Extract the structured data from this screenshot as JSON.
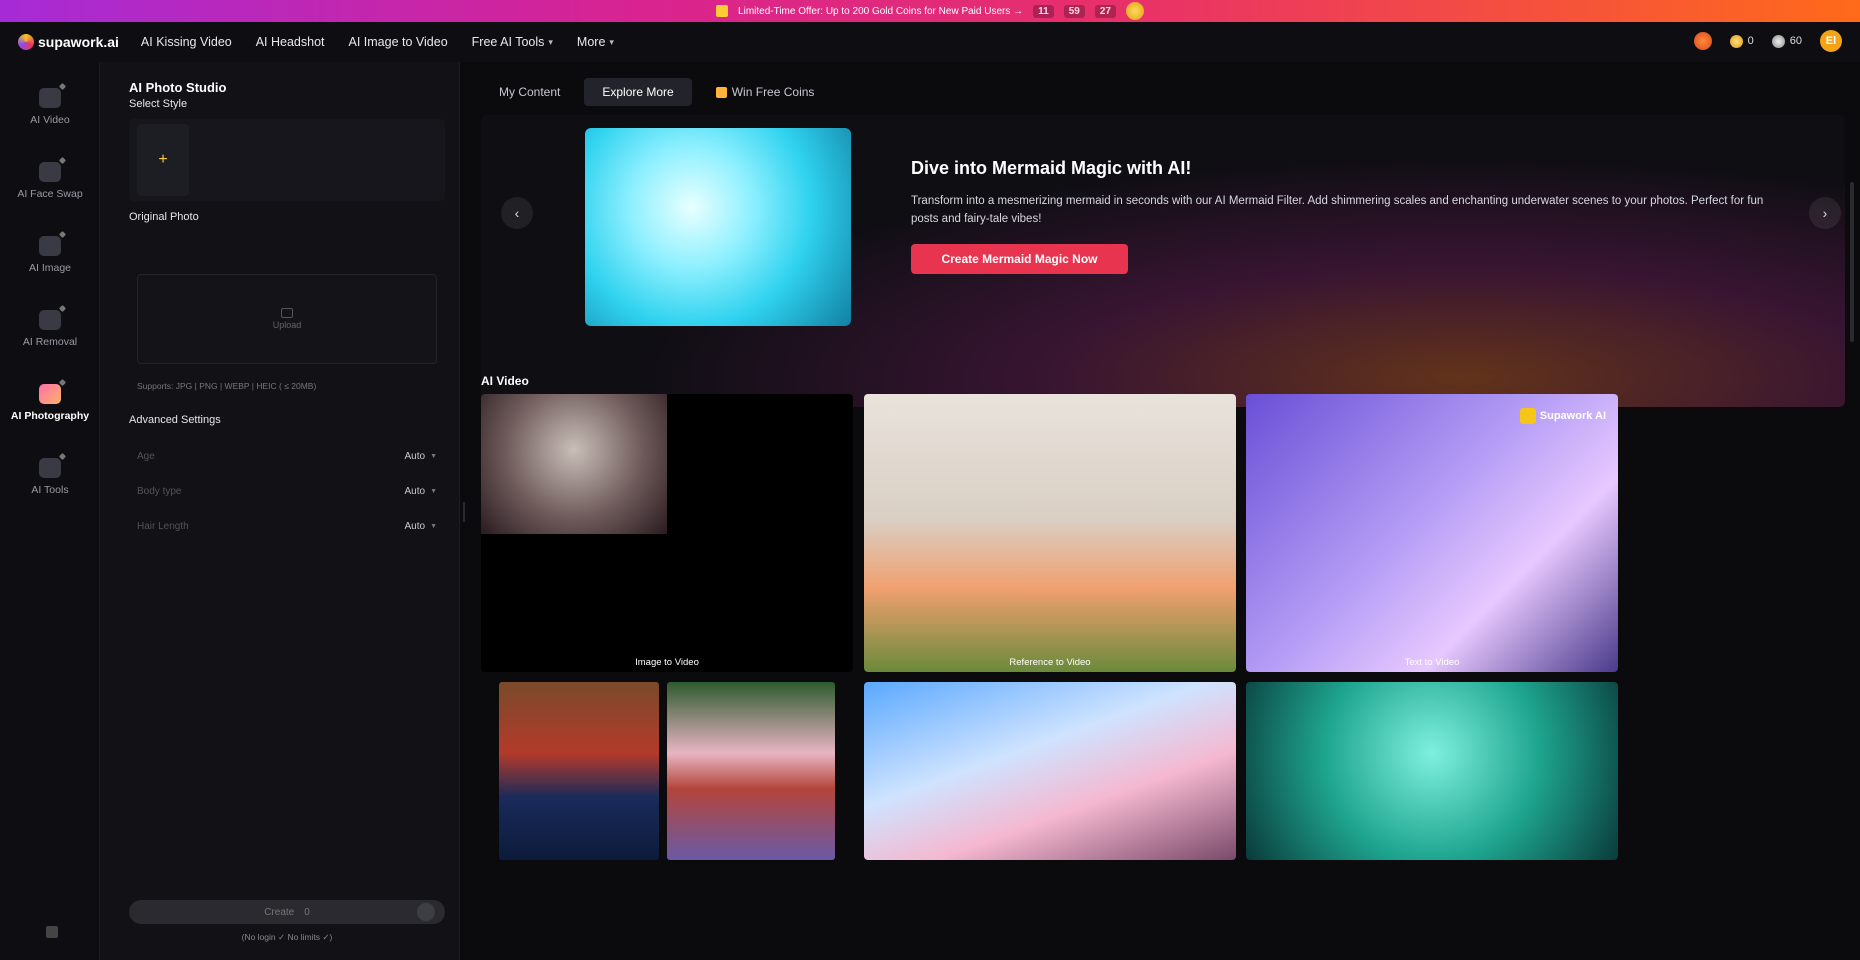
{
  "promo": {
    "text": "Limited-Time Offer: Up to 200 Gold Coins for New Paid Users →",
    "countdown": [
      "11",
      "59",
      "27"
    ]
  },
  "topnav": {
    "logo": "supawork.ai",
    "links": [
      {
        "label": "AI Kissing Video"
      },
      {
        "label": "AI Headshot"
      },
      {
        "label": "AI Image to Video"
      },
      {
        "label": "Free AI Tools",
        "dropdown": true
      },
      {
        "label": "More",
        "dropdown": true
      }
    ],
    "gold_coins": "0",
    "silver_coins": "60",
    "avatar_initial": "El"
  },
  "rail": {
    "items": [
      {
        "label": "AI Video",
        "icon": "video-icon"
      },
      {
        "label": "AI Face Swap",
        "icon": "face-swap-icon"
      },
      {
        "label": "AI Image",
        "icon": "image-icon"
      },
      {
        "label": "AI Removal",
        "icon": "eraser-icon"
      },
      {
        "label": "AI Photography",
        "icon": "camera-icon",
        "active": true
      },
      {
        "label": "AI Tools",
        "icon": "tools-icon"
      }
    ]
  },
  "panel": {
    "title": "AI Photo Studio",
    "select_style_label": "Select Style",
    "add_style_symbol": "+",
    "original_photo_label": "Original Photo",
    "upload_label": "Upload",
    "supports_text": "Supports: JPG | PNG | WEBP | HEIC ( ≤ 20MB)",
    "advanced_label": "Advanced Settings",
    "settings": [
      {
        "label": "Age",
        "value": "Auto"
      },
      {
        "label": "Body type",
        "value": "Auto"
      },
      {
        "label": "Hair Length",
        "value": "Auto"
      }
    ],
    "create_label": "Create",
    "create_cost": "0",
    "no_limit_text": "(No login ✓ No limits ✓)"
  },
  "main": {
    "tabs": [
      {
        "label": "My Content"
      },
      {
        "label": "Explore More",
        "active": true
      },
      {
        "label": "Win Free Coins"
      }
    ],
    "hero": {
      "title": "Dive into Mermaid Magic with AI!",
      "description": "Transform into a mesmerizing mermaid in seconds with our AI Mermaid Filter. Add shimmering scales and enchanting underwater scenes to your photos. Perfect for fun posts and fairy-tale vibes!",
      "cta": "Create Mermaid Magic Now"
    },
    "section_title": "AI Video",
    "cards": [
      {
        "caption": "Image to Video"
      },
      {
        "caption": "Reference to Video"
      },
      {
        "caption": "Text to Video",
        "badge": "Supawork AI"
      }
    ]
  }
}
